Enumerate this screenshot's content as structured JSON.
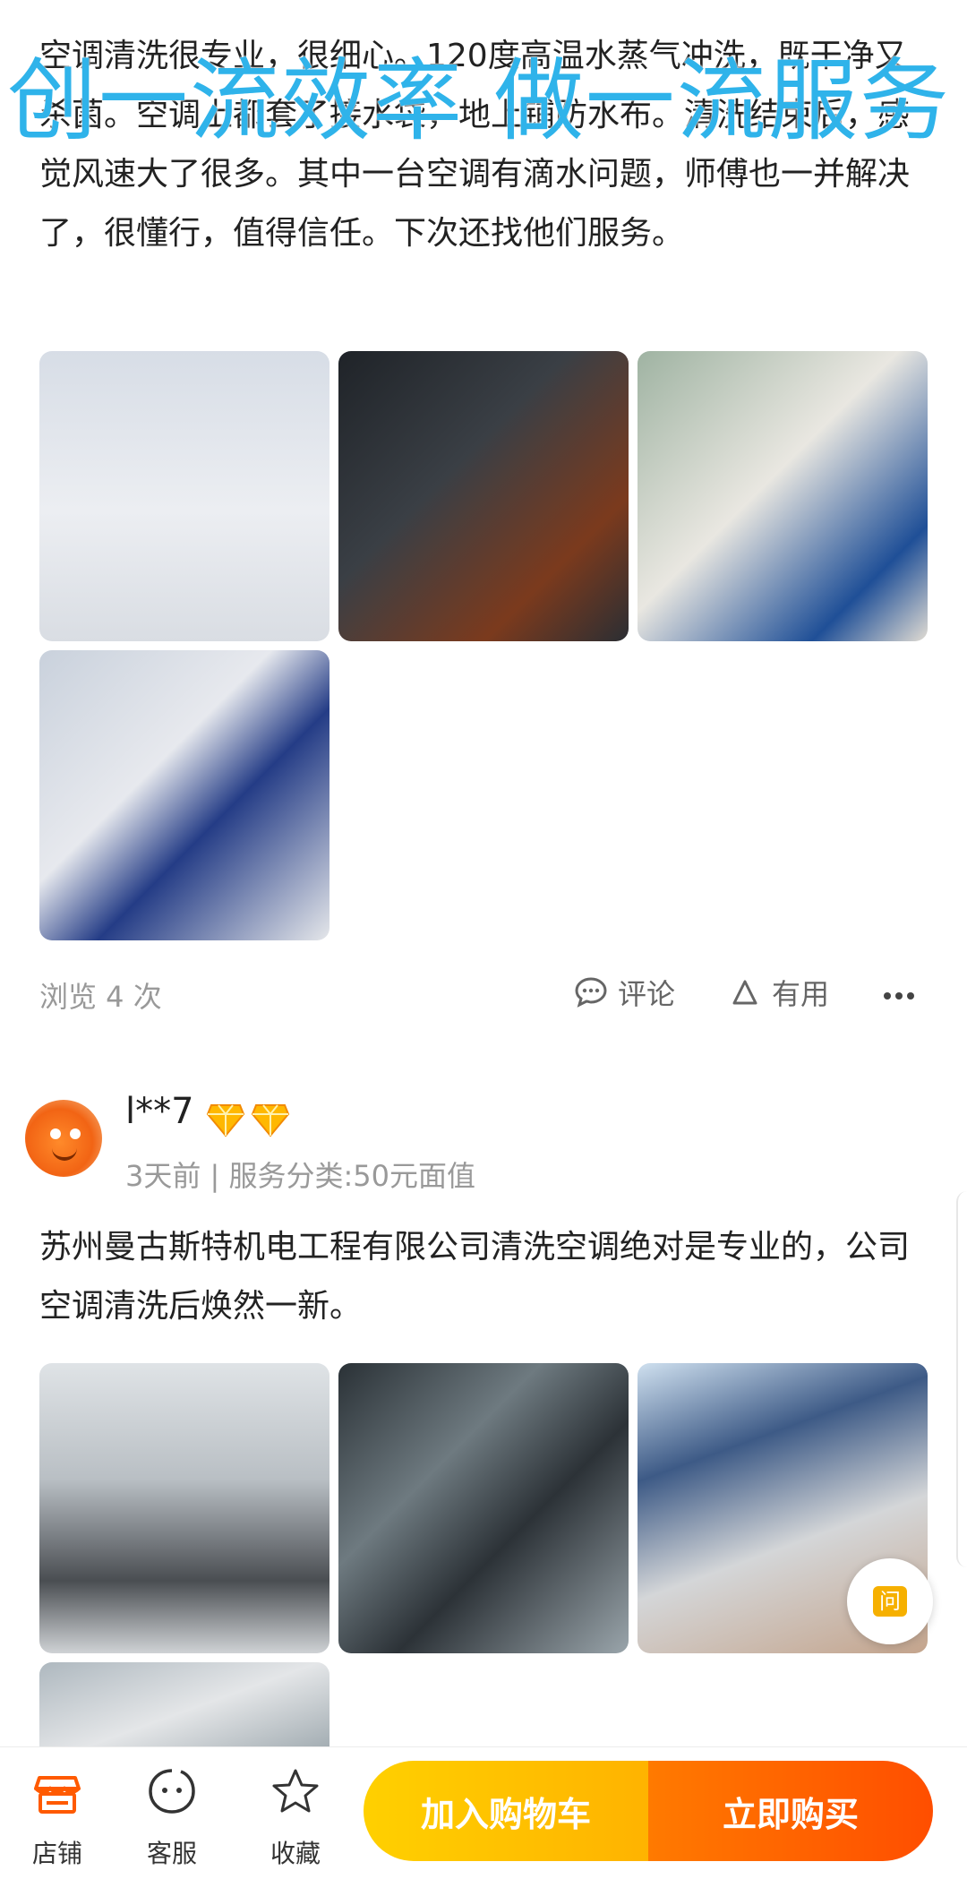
{
  "watermark": "创一流效率 做一流服务",
  "review1": {
    "text": "空调清洗很专业，很细心。120度高温水蒸气冲洗，既干净又杀菌。空调上都套了接水袋，地上铺防水布。清洗结束后，感觉风速大了很多。其中一台空调有滴水问题，师傅也一并解决了，很懂行，值得信任。下次还找他们服务。",
    "views": "浏览 4 次",
    "comment_label": "评论",
    "useful_label": "有用"
  },
  "review2": {
    "username": "l**7",
    "subinfo": "3天前 | 服务分类:50元面值",
    "text": "苏州曼古斯特机电工程有限公司清洗空调绝对是专业的，公司空调清洗后焕然一新。"
  },
  "float_button_label": "问",
  "bottom_nav": {
    "shop": "店铺",
    "service": "客服",
    "favorite": "收藏",
    "add_cart": "加入购物车",
    "buy_now": "立即购买"
  },
  "colors": {
    "accent_orange": "#ff5a00",
    "accent_yellow": "#ffc400",
    "watermark_blue": "#2fb3ea"
  }
}
